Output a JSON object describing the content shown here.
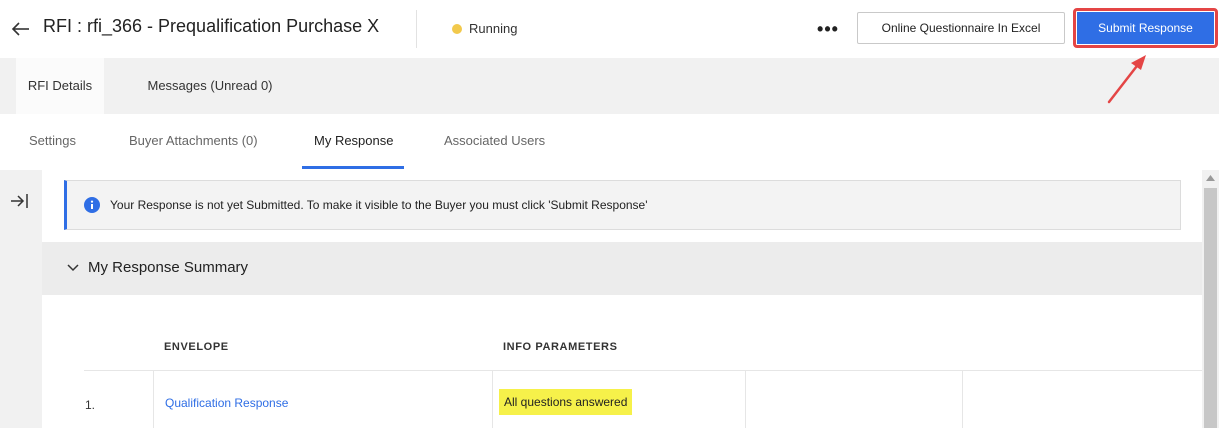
{
  "header": {
    "title": "RFI : rfi_366 - Prequalification Purchase X",
    "status": "Running",
    "more": "•••",
    "excel_button": "Online Questionnaire In Excel",
    "submit_button": "Submit Response"
  },
  "primary_tabs": [
    {
      "label": "RFI Details",
      "active": true
    },
    {
      "label": "Messages (Unread 0)",
      "active": false
    }
  ],
  "secondary_tabs": [
    {
      "label": "Settings",
      "active": false
    },
    {
      "label": "Buyer Attachments (0)",
      "active": false
    },
    {
      "label": "My Response",
      "active": true
    },
    {
      "label": "Associated Users",
      "active": false
    }
  ],
  "banner": {
    "text": "Your Response is not yet Submitted. To make it visible to the Buyer you must click 'Submit Response'"
  },
  "summary": {
    "title": "My Response Summary",
    "columns": [
      "ENVELOPE",
      "INFO PARAMETERS"
    ],
    "rows": [
      {
        "number": "1.",
        "envelope": "Qualification Response",
        "info": "All questions answered"
      }
    ]
  },
  "icons": {
    "back": "back-arrow-icon",
    "expand": "expand-panel-icon",
    "info": "info-icon",
    "chevron": "chevron-down-icon",
    "annotation": "red-arrow-annotation"
  },
  "colors": {
    "accent": "#2f6ee5",
    "status_dot": "#f2c94c",
    "annotation": "#e44545",
    "highlight": "#f6f14a"
  }
}
